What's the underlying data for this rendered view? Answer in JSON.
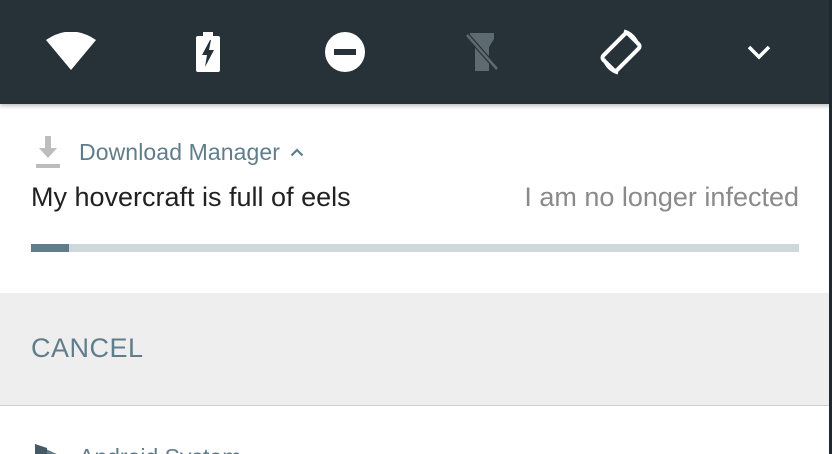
{
  "quick_settings": {
    "background": "#263238",
    "tiles": [
      {
        "name": "wifi",
        "icon": "wifi-icon",
        "state": "on"
      },
      {
        "name": "battery-saver",
        "icon": "battery-charging-icon",
        "state": "on"
      },
      {
        "name": "do-not-disturb",
        "icon": "do-not-disturb-icon",
        "state": "on"
      },
      {
        "name": "flashlight",
        "icon": "flashlight-off-icon",
        "state": "off"
      },
      {
        "name": "auto-rotate",
        "icon": "screen-rotation-icon",
        "state": "on"
      },
      {
        "name": "expand",
        "icon": "chevron-down-icon"
      }
    ]
  },
  "notification": {
    "app_icon": "download-icon",
    "app_name": "Download Manager",
    "expand_icon": "chevron-up-icon",
    "title": "My hovercraft is full of eels",
    "text": "I am no longer infected",
    "progress": 0.05,
    "accent": "#607d8b",
    "track_color": "#cfd8dc"
  },
  "actions": {
    "cancel_label": "CANCEL"
  },
  "next_notification": {
    "app_icon": "android-system-icon",
    "app_name": "Android System"
  }
}
